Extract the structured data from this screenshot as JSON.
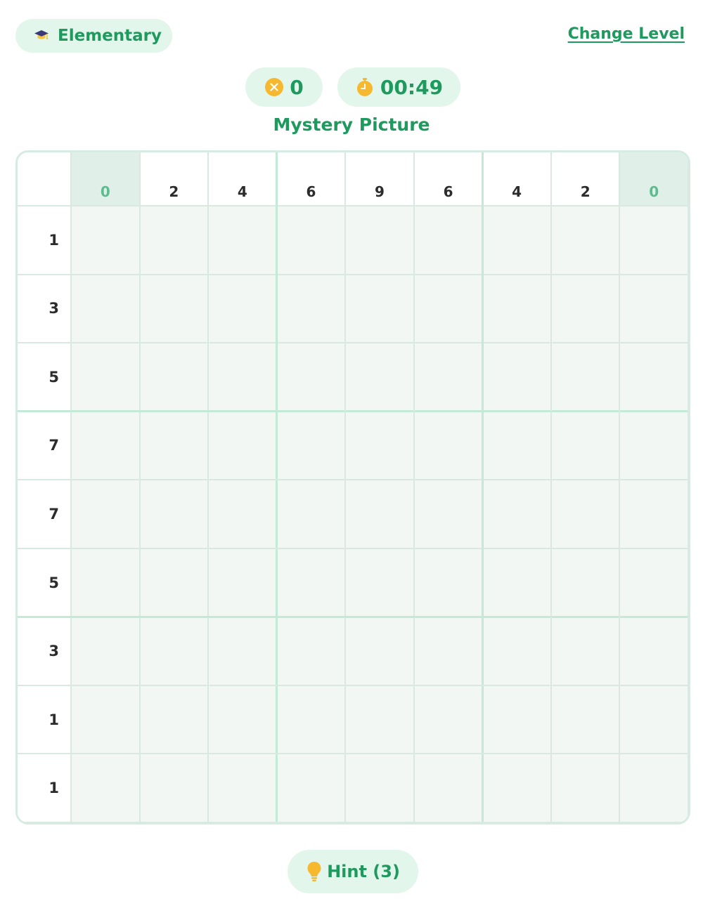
{
  "header": {
    "level_label": "Elementary",
    "change_level_label": "Change Level"
  },
  "stats": {
    "mistakes": "0",
    "timer": "00:49"
  },
  "puzzle": {
    "title": "Mystery Picture",
    "size": 9,
    "column_clues": [
      "0",
      "2",
      "4",
      "6",
      "9",
      "6",
      "4",
      "2",
      "0"
    ],
    "row_clues": [
      "1",
      "3",
      "5",
      "7",
      "7",
      "5",
      "3",
      "1",
      "1"
    ],
    "filled_cells": []
  },
  "hint": {
    "label": "Hint (3)",
    "remaining": 3
  },
  "colors": {
    "accent": "#1f9a5f",
    "pill_background": "#e3f6ec",
    "cell_empty": "#f2f7f4",
    "zero_clue_background": "#e0f0e8",
    "zero_clue_text": "#5bbd8e",
    "icon_gold": "#f5b82e"
  },
  "icons": {
    "level": "graduation-cap-icon",
    "mistakes": "x-circle-icon",
    "timer": "stopwatch-icon",
    "hint": "lightbulb-icon"
  }
}
